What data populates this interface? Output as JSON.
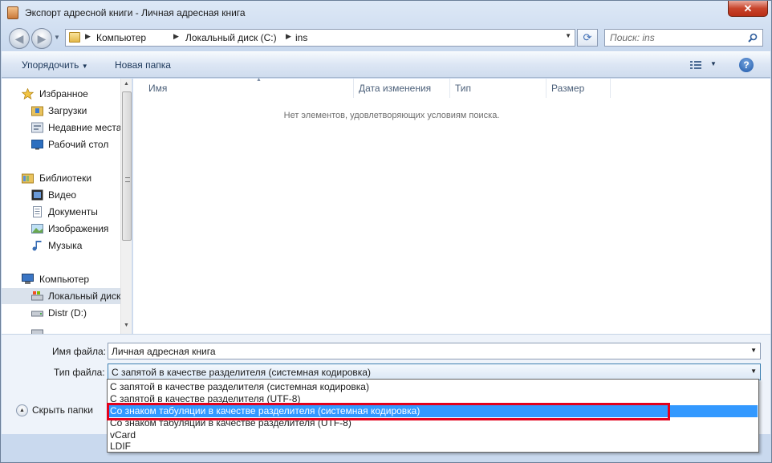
{
  "window": {
    "title": "Экспорт адресной книги - Личная адресная книга",
    "close_glyph": "✕"
  },
  "address": {
    "crumbs": [
      "Компьютер",
      "Локальный диск (C:)",
      "ins"
    ],
    "search_placeholder": "Поиск: ins"
  },
  "toolbar": {
    "organize": "Упорядочить",
    "organize_arrow": "▼",
    "new_folder": "Новая папка",
    "help": "?"
  },
  "nav": {
    "favorites": "Избранное",
    "downloads": "Загрузки",
    "recent": "Недавние места",
    "desktop": "Рабочий стол",
    "libraries": "Библиотеки",
    "video": "Видео",
    "documents": "Документы",
    "images": "Изображения",
    "music": "Музыка",
    "computer": "Компьютер",
    "local_disk": "Локальный диск",
    "distr": "Distr (D:)"
  },
  "columns": {
    "name": "Имя",
    "date": "Дата изменения",
    "type": "Тип",
    "size": "Размер"
  },
  "empty_message": "Нет элементов, удовлетворяющих условиям поиска.",
  "form": {
    "filename_label": "Имя файла:",
    "filename_value": "Личная адресная книга",
    "filetype_label": "Тип файла:",
    "filetype_value": "С запятой в качестве разделителя (системная кодировка)"
  },
  "hide_folders": "Скрыть папки",
  "dropdown_options": [
    "С запятой в качестве разделителя (системная кодировка)",
    "С запятой в качестве разделителя (UTF-8)",
    "Со знаком табуляции в качестве разделителя (системная кодировка)",
    "Со знаком табуляции в качестве разделителя (UTF-8)",
    "vCard",
    "LDIF"
  ],
  "highlighted_option_index": 2,
  "colors": {
    "highlight": "#3399ff",
    "annotation_outline": "#e4001b",
    "close_button": "#c8442b"
  }
}
